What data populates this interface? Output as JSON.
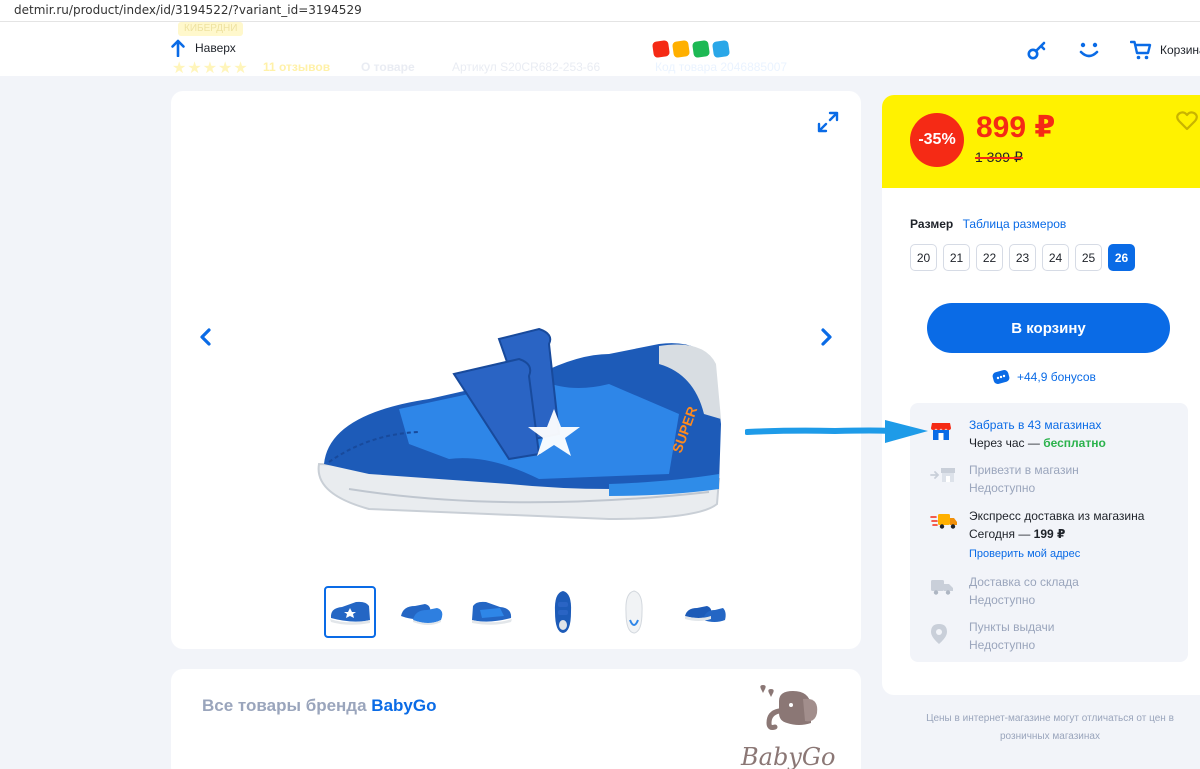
{
  "url": "detmir.ru/product/index/id/3194522/?variant_id=3194529",
  "header": {
    "badge_ghost": "КИБЕРДНИ",
    "reviews_ghost": "11 отзывов",
    "about_ghost": "О товаре",
    "article_ghost": "Артикул S20CR682-253-66",
    "code_ghost": "Код товара 2046885007",
    "up_link": "Наверх",
    "cart_label": "Корзина",
    "logo_colors": [
      "#f52a15",
      "#ffb000",
      "#1db954",
      "#2aa7e8"
    ]
  },
  "gallery": {
    "thumbnail_count": 6,
    "active_thumbnail": 0
  },
  "brand": {
    "prefix": "Все товары бренда",
    "name": "BabyGo",
    "logo_text": "BabyGo"
  },
  "purchase": {
    "discount": "-35%",
    "price": "899 ₽",
    "old_price": "1 399 ₽",
    "size_label": "Размер",
    "size_table_link": "Таблица размеров",
    "sizes": [
      "20",
      "21",
      "22",
      "23",
      "24",
      "25",
      "26"
    ],
    "selected_size": "26",
    "cart_button": "В корзину",
    "bonus": "+44,9 бонусов"
  },
  "delivery": [
    {
      "icon": "store-icon",
      "title": "Забрать в 43 магазинах",
      "sub_prefix": "Через час — ",
      "sub_value": "бесплатно",
      "state": "available"
    },
    {
      "icon": "store-transfer-icon",
      "title": "Привезти в магазин",
      "sub": "Недоступно",
      "state": "unavailable"
    },
    {
      "icon": "express-truck-icon",
      "title": "Экспресс доставка из магазина",
      "sub_prefix": "Сегодня — ",
      "sub_value": "199 ₽",
      "link": "Проверить мой адрес",
      "state": "available"
    },
    {
      "icon": "warehouse-truck-icon",
      "title": "Доставка со склада",
      "sub": "Недоступно",
      "state": "unavailable"
    },
    {
      "icon": "map-pin-icon",
      "title": "Пункты выдачи",
      "sub": "Недоступно",
      "state": "unavailable"
    }
  ],
  "note": "Цены в интернет-магазине могут отличаться от цен в розничных магазинах"
}
